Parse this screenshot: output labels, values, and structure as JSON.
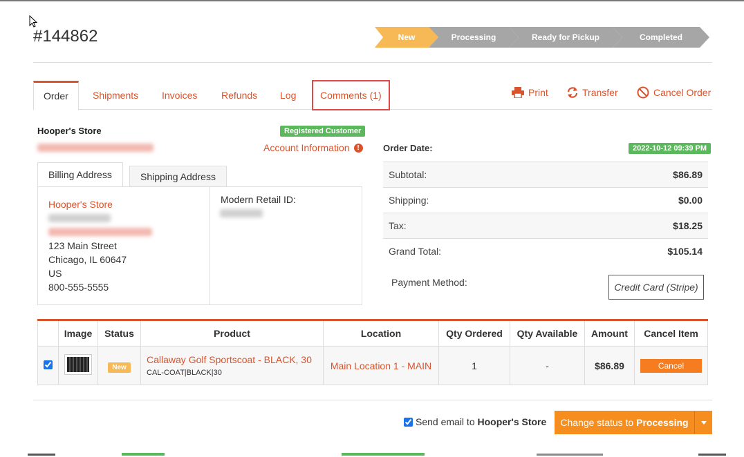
{
  "order": {
    "number": "#144862"
  },
  "status_steps": [
    "New",
    "Processing",
    "Ready for Pickup",
    "Completed"
  ],
  "tabs": {
    "order": "Order",
    "shipments": "Shipments",
    "invoices": "Invoices",
    "refunds": "Refunds",
    "log": "Log",
    "comments": "Comments (1)"
  },
  "actions": {
    "print": "Print",
    "transfer": "Transfer",
    "cancel_order": "Cancel Order"
  },
  "customer": {
    "store_name": "Hooper's Store",
    "badge": "Registered Customer",
    "account_info": "Account Information"
  },
  "address": {
    "billing_tab": "Billing Address",
    "shipping_tab": "Shipping Address",
    "name": "Hooper's Store",
    "street": "123 Main Street",
    "city": "Chicago, IL 60647",
    "country": "US",
    "phone": "800-555-5555",
    "modern_retail_id_label": "Modern Retail ID:"
  },
  "summary": {
    "order_date_label": "Order Date:",
    "order_date": "2022-10-12 09:39 PM",
    "rows": [
      {
        "label": "Subtotal:",
        "value": "$86.89"
      },
      {
        "label": "Shipping:",
        "value": "$0.00"
      },
      {
        "label": "Tax:",
        "value": "$18.25"
      },
      {
        "label": "Grand Total:",
        "value": "$105.14"
      }
    ],
    "payment_method_label": "Payment Method:",
    "payment_method": "Credit Card (Stripe)"
  },
  "items_table": {
    "headers": [
      "",
      "Image",
      "Status",
      "Product",
      "Location",
      "Qty Ordered",
      "Qty Available",
      "Amount",
      "Cancel Item"
    ],
    "rows": [
      {
        "checked": true,
        "status": "New",
        "product": "Callaway Golf Sportscoat - BLACK, 30",
        "sku": "CAL-COAT|BLACK|30",
        "location": "Main Location 1 - MAIN",
        "qty_ordered": "1",
        "qty_available": "-",
        "amount": "$86.89",
        "cancel_label": "Cancel"
      }
    ]
  },
  "footer": {
    "send_email_prefix": "Send email to ",
    "send_email_store": "Hooper's Store",
    "send_email_checked": true,
    "change_status_prefix": "Change status to ",
    "change_status_target": "Processing"
  },
  "colors": {
    "accent": "#d9532c",
    "step_active": "#f7b955",
    "step_inactive": "#a6a6a6",
    "success": "#5cb85c",
    "button": "#f58d1f"
  },
  "icons": [
    "cursor-icon",
    "print-icon",
    "transfer-icon",
    "cancel-icon",
    "info-icon",
    "caret-down-icon"
  ]
}
